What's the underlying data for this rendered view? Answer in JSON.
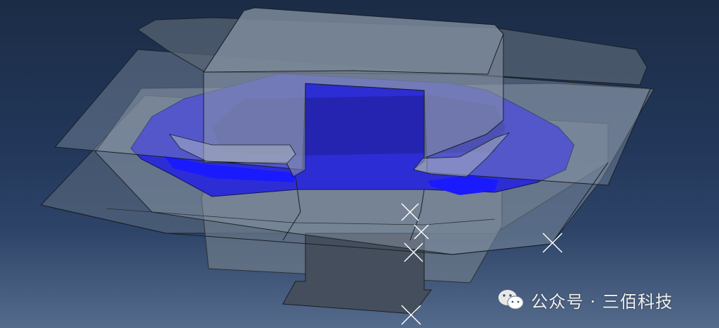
{
  "viewport": {
    "background_top": "#1b2c46",
    "background_bottom": "#556b8c"
  },
  "model": {
    "part_color": "#2d2dd6",
    "contact_highlight_color": "#1a1aff",
    "shell_color": "#8a9bb2",
    "node_marker_color": "#ffffff"
  },
  "watermark": {
    "icon": "wechat-icon",
    "text": "公众号 · 三佰科技"
  }
}
